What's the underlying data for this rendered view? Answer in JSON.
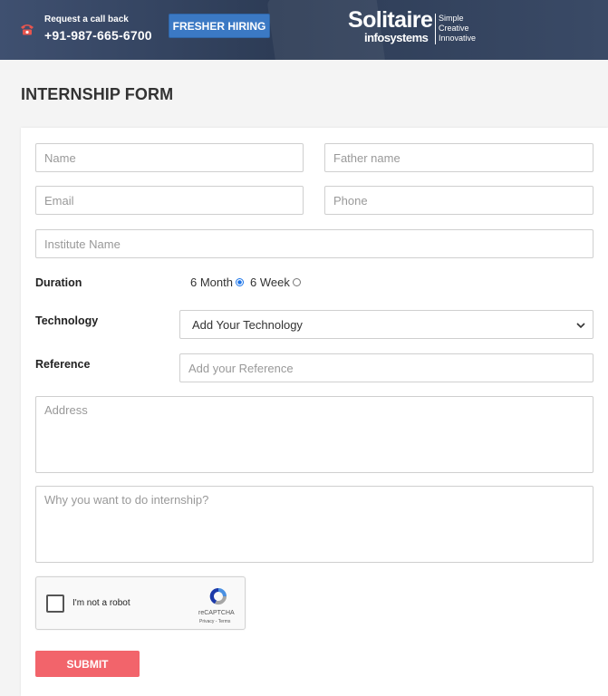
{
  "header": {
    "call_label": "Request a call back",
    "phone": "+91-987-665-6700",
    "fresher_label": "FRESHER HIRING",
    "logo_main": "Solitaire",
    "logo_sub": "infosystems",
    "logo_tags": [
      "Simple",
      "Creative",
      "Innovative"
    ],
    "colors": {
      "header_bg": "#33425f",
      "fresher_btn": "#3b79c4",
      "phone_icon": "#e8554e"
    }
  },
  "page": {
    "title": "INTERNSHIP FORM"
  },
  "form": {
    "name_placeholder": "Name",
    "father_placeholder": "Father name",
    "email_placeholder": "Email",
    "phone_placeholder": "Phone",
    "institute_placeholder": "Institute Name",
    "duration_label": "Duration",
    "duration_options": [
      {
        "label": "6 Month",
        "selected": true
      },
      {
        "label": "6 Week",
        "selected": false
      }
    ],
    "technology_label": "Technology",
    "technology_value": "Add Your Technology",
    "reference_label": "Reference",
    "reference_placeholder": "Add your Reference",
    "address_placeholder": "Address",
    "why_placeholder": "Why you want to do internship?",
    "captcha_label": "I'm not a robot",
    "captcha_brand": "reCAPTCHA",
    "captcha_links": "Privacy - Terms",
    "submit_label": "SUBMIT",
    "submit_color": "#f2646b"
  }
}
